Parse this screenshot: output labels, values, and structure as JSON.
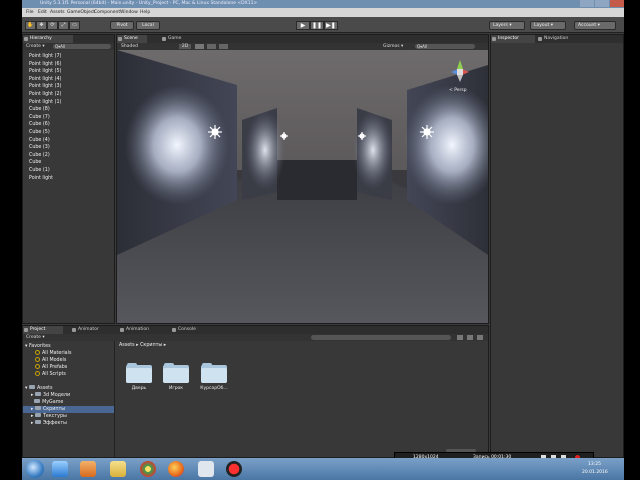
{
  "window": {
    "title": "Unity 5.3.1f1 Personal (64bit) - Main.unity - Unity_Project - PC, Mac & Linux Standalone <DX11>"
  },
  "menu": [
    "File",
    "Edit",
    "Assets",
    "GameObject",
    "Component",
    "Window",
    "Help"
  ],
  "toolbar": {
    "tools": [
      "✋",
      "✥",
      "⟳",
      "⤢",
      "▭"
    ],
    "pivot_label": "Pivot",
    "local_label": "Local",
    "play_icons": [
      "▶",
      "❚❚",
      "▶❚"
    ],
    "layers_label": "Layers",
    "layout_label": "Layout",
    "account_label": "Account"
  },
  "hierarchy": {
    "tab_label": "Hierarchy",
    "create_label": "Create ▾",
    "search_placeholder": "Q▾All",
    "items": [
      "Point light (7)",
      "Point light (6)",
      "Point light (5)",
      "Point light (4)",
      "Point light (3)",
      "Point light (2)",
      "Point light (1)",
      "Cube (8)",
      "Cube (7)",
      "Cube (6)",
      "Cube (5)",
      "Cube (4)",
      "Cube (3)",
      "Cube (2)",
      "Cube",
      "Cube (1)",
      "Point light"
    ]
  },
  "scene": {
    "tabs": [
      "Scene",
      "Game"
    ],
    "shading": "Shaded",
    "mode_2d": "2D",
    "gizmos_label": "Gizmos ▾",
    "search_placeholder": "Q▾All",
    "view_label": "< Persp"
  },
  "inspector": {
    "tabs": [
      "Inspector",
      "Navigation"
    ]
  },
  "project": {
    "tabs": [
      "Project",
      "Animator",
      "Animation",
      "Console"
    ],
    "create_label": "Create ▾",
    "favorites_label": "Favorites",
    "favorites": [
      "All Materials",
      "All Models",
      "All Prefabs",
      "All Scripts"
    ],
    "assets_label": "Assets",
    "asset_folders": [
      "3d Модели",
      "MyGame",
      "Скрипты",
      "Текстуры",
      "Эффекты"
    ],
    "breadcrumb": "Assets ▸ Скрипты ▸",
    "folders": [
      "Дверь",
      "Игрок",
      "КурсорОб..."
    ]
  },
  "taskbar": {
    "screen_size": "1280x1024",
    "record_label": "Запись 00:01:30",
    "time": "13:25",
    "date": "20.01.2016"
  },
  "colors": {
    "editor_bg": "#3b3b3b",
    "panel_bg": "#383838",
    "selection": "#4a6793",
    "taskbar": "#5c87b3"
  }
}
